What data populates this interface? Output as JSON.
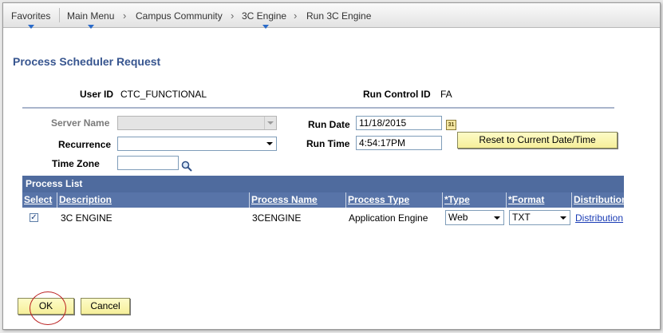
{
  "nav": {
    "items": [
      "Favorites",
      "Main Menu",
      "Campus Community",
      "3C Engine",
      "Run 3C Engine"
    ]
  },
  "page_title": "Process Scheduler Request",
  "header": {
    "user_id_label": "User ID",
    "user_id_value": "CTC_FUNCTIONAL",
    "run_control_label": "Run Control ID",
    "run_control_value": "FA"
  },
  "form": {
    "server_name_label": "Server Name",
    "server_name_value": "",
    "recurrence_label": "Recurrence",
    "recurrence_value": "",
    "time_zone_label": "Time Zone",
    "time_zone_value": "",
    "run_date_label": "Run Date",
    "run_date_value": "11/18/2015",
    "run_time_label": "Run Time",
    "run_time_value": "4:54:17PM",
    "reset_button": "Reset to Current Date/Time",
    "calendar_icon_text": "31"
  },
  "process_list": {
    "title": "Process List",
    "columns": [
      "Select",
      "Description",
      "Process Name",
      "Process Type",
      "*Type",
      "*Format",
      "Distribution"
    ],
    "rows": [
      {
        "selected": true,
        "description": "3C ENGINE",
        "process_name": "3CENGINE",
        "process_type": "Application Engine",
        "type": "Web",
        "format": "TXT",
        "distribution": "Distribution"
      }
    ]
  },
  "buttons": {
    "ok": "OK",
    "cancel": "Cancel"
  },
  "colors": {
    "title": "#37558f",
    "grid_header": "#4f6b9e",
    "button_bg": "#f6ef9a",
    "link": "#1a3cb5",
    "annotation_circle": "#b22222"
  },
  "icons": {
    "nav_chevron": "chevron-right-icon",
    "nav_caret": "caret-down-icon",
    "lookup": "search-icon",
    "calendar": "calendar-icon",
    "dropdown": "chevron-down-icon",
    "checkbox": "checkbox-checked-icon"
  }
}
